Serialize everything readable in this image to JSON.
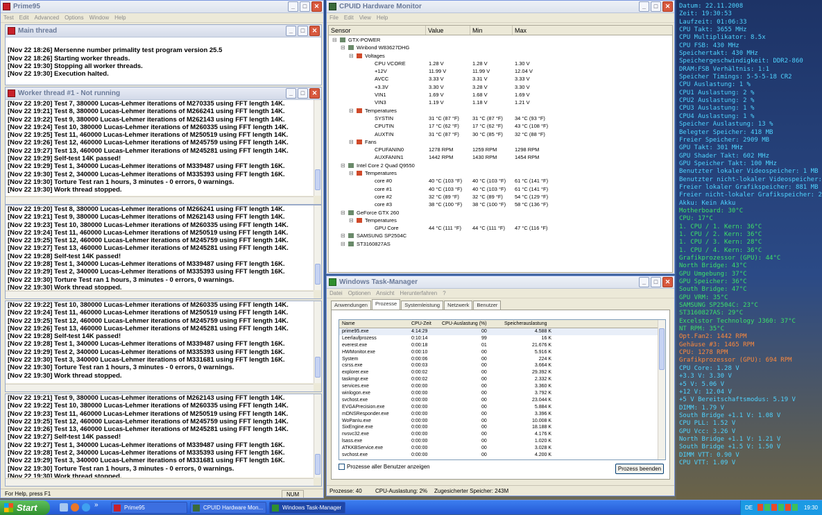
{
  "prime95": {
    "title": "Prime95",
    "menu": [
      "Test",
      "Edit",
      "Advanced",
      "Options",
      "Window",
      "Help"
    ],
    "main_thread": {
      "title": "Main thread",
      "lines": [
        "",
        "[Nov 22 18:26] Mersenne number primality test program version 25.5",
        "[Nov 22 18:26] Starting worker threads.",
        "[Nov 22 19:30] Stopping all worker threads.",
        "[Nov 22 19:30] Execution halted."
      ]
    },
    "worker1": {
      "title": "Worker thread #1 - Not running",
      "lines": [
        "[Nov 22 19:20] Test 7, 380000 Lucas-Lehmer iterations of M270335 using FFT length 14K.",
        "[Nov 22 19:21] Test 8, 380000 Lucas-Lehmer iterations of M266241 using FFT length 14K.",
        "[Nov 22 19:22] Test 9, 380000 Lucas-Lehmer iterations of M262143 using FFT length 14K.",
        "[Nov 22 19:24] Test 10, 380000 Lucas-Lehmer iterations of M260335 using FFT length 14K.",
        "[Nov 22 19:25] Test 11, 460000 Lucas-Lehmer iterations of M250519 using FFT length 14K.",
        "[Nov 22 19:26] Test 12, 460000 Lucas-Lehmer iterations of M245759 using FFT length 14K.",
        "[Nov 22 19:27] Test 13, 460000 Lucas-Lehmer iterations of M245281 using FFT length 14K.",
        "[Nov 22 19:29] Self-test 14K passed!",
        "[Nov 22 19:29] Test 1, 340000 Lucas-Lehmer iterations of M339487 using FFT length 16K.",
        "[Nov 22 19:30] Test 2, 340000 Lucas-Lehmer iterations of M335393 using FFT length 16K.",
        "[Nov 22 19:30] Torture Test ran 1 hours, 3 minutes - 0 errors, 0 warnings.",
        "[Nov 22 19:30] Work thread stopped."
      ]
    },
    "worker2": {
      "lines": [
        "[Nov 22 19:20] Test 8, 380000 Lucas-Lehmer iterations of M266241 using FFT length 14K.",
        "[Nov 22 19:21] Test 9, 380000 Lucas-Lehmer iterations of M262143 using FFT length 14K.",
        "[Nov 22 19:23] Test 10, 380000 Lucas-Lehmer iterations of M260335 using FFT length 14K.",
        "[Nov 22 19:24] Test 11, 460000 Lucas-Lehmer iterations of M250519 using FFT length 14K.",
        "[Nov 22 19:25] Test 12, 460000 Lucas-Lehmer iterations of M245759 using FFT length 14K.",
        "[Nov 22 19:27] Test 13, 460000 Lucas-Lehmer iterations of M245281 using FFT length 14K.",
        "[Nov 22 19:28] Self-test 14K passed!",
        "[Nov 22 19:28] Test 1, 340000 Lucas-Lehmer iterations of M339487 using FFT length 16K.",
        "[Nov 22 19:29] Test 2, 340000 Lucas-Lehmer iterations of M335393 using FFT length 16K.",
        "[Nov 22 19:30] Torture Test ran 1 hours, 3 minutes - 0 errors, 0 warnings.",
        "[Nov 22 19:30] Work thread stopped."
      ]
    },
    "worker3": {
      "lines": [
        "[Nov 22 19:22] Test 10, 380000 Lucas-Lehmer iterations of M260335 using FFT length 14K.",
        "[Nov 22 19:24] Test 11, 460000 Lucas-Lehmer iterations of M250519 using FFT length 14K.",
        "[Nov 22 19:25] Test 12, 460000 Lucas-Lehmer iterations of M245759 using FFT length 14K.",
        "[Nov 22 19:26] Test 13, 460000 Lucas-Lehmer iterations of M245281 using FFT length 14K.",
        "[Nov 22 19:28] Self-test 14K passed!",
        "[Nov 22 19:28] Test 1, 340000 Lucas-Lehmer iterations of M339487 using FFT length 16K.",
        "[Nov 22 19:29] Test 2, 340000 Lucas-Lehmer iterations of M335393 using FFT length 16K.",
        "[Nov 22 19:30] Test 3, 340000 Lucas-Lehmer iterations of M331681 using FFT length 16K.",
        "[Nov 22 19:30] Torture Test ran 1 hours, 3 minutes - 0 errors, 0 warnings.",
        "[Nov 22 19:30] Work thread stopped."
      ]
    },
    "worker4": {
      "lines": [
        "[Nov 22 19:21] Test 9, 380000 Lucas-Lehmer iterations of M262143 using FFT length 14K.",
        "[Nov 22 19:22] Test 10, 380000 Lucas-Lehmer iterations of M260335 using FFT length 14K.",
        "[Nov 22 19:23] Test 11, 460000 Lucas-Lehmer iterations of M250519 using FFT length 14K.",
        "[Nov 22 19:25] Test 12, 460000 Lucas-Lehmer iterations of M245759 using FFT length 14K.",
        "[Nov 22 19:26] Test 13, 460000 Lucas-Lehmer iterations of M245281 using FFT length 14K.",
        "[Nov 22 19:27] Self-test 14K passed!",
        "[Nov 22 19:27] Test 1, 340000 Lucas-Lehmer iterations of M339487 using FFT length 16K.",
        "[Nov 22 19:28] Test 2, 340000 Lucas-Lehmer iterations of M335393 using FFT length 16K.",
        "[Nov 22 19:29] Test 3, 340000 Lucas-Lehmer iterations of M331681 using FFT length 16K.",
        "[Nov 22 19:30] Torture Test ran 1 hours, 3 minutes - 0 errors, 0 warnings.",
        "[Nov 22 19:30] Work thread stopped."
      ]
    },
    "status_left": "For Help, press F1",
    "status_right": "NUM"
  },
  "hwmon": {
    "title": "CPUID Hardware Monitor",
    "menu": [
      "File",
      "Edit",
      "View",
      "Help"
    ],
    "columns": [
      "Sensor",
      "Value",
      "Min",
      "Max"
    ],
    "rows": [
      {
        "l": 0,
        "t": "GTX-POWER",
        "v": "",
        "mn": "",
        "mx": ""
      },
      {
        "l": 1,
        "t": "Winbond W83627DHG",
        "v": "",
        "mn": "",
        "mx": ""
      },
      {
        "l": 2,
        "t": "Voltages",
        "v": "",
        "mn": "",
        "mx": ""
      },
      {
        "l": 3,
        "t": "CPU VCORE",
        "v": "1.28 V",
        "mn": "1.28 V",
        "mx": "1.30 V"
      },
      {
        "l": 3,
        "t": "+12V",
        "v": "11.99 V",
        "mn": "11.99 V",
        "mx": "12.04 V"
      },
      {
        "l": 3,
        "t": "AVCC",
        "v": "3.33 V",
        "mn": "3.31 V",
        "mx": "3.33 V"
      },
      {
        "l": 3,
        "t": "+3.3V",
        "v": "3.30 V",
        "mn": "3.28 V",
        "mx": "3.30 V"
      },
      {
        "l": 3,
        "t": "VIN1",
        "v": "1.69 V",
        "mn": "1.68 V",
        "mx": "1.69 V"
      },
      {
        "l": 3,
        "t": "VIN3",
        "v": "1.19 V",
        "mn": "1.18 V",
        "mx": "1.21 V"
      },
      {
        "l": 2,
        "t": "Temperatures",
        "v": "",
        "mn": "",
        "mx": ""
      },
      {
        "l": 3,
        "t": "SYSTIN",
        "v": "31 °C (87 °F)",
        "mn": "31 °C (87 °F)",
        "mx": "34 °C (93 °F)"
      },
      {
        "l": 3,
        "t": "CPUTIN",
        "v": "17 °C (62 °F)",
        "mn": "17 °C (62 °F)",
        "mx": "43 °C (108 °F)"
      },
      {
        "l": 3,
        "t": "AUXTIN",
        "v": "31 °C (87 °F)",
        "mn": "30 °C (85 °F)",
        "mx": "32 °C (88 °F)"
      },
      {
        "l": 2,
        "t": "Fans",
        "v": "",
        "mn": "",
        "mx": ""
      },
      {
        "l": 3,
        "t": "CPUFANIN0",
        "v": "1278 RPM",
        "mn": "1259 RPM",
        "mx": "1298 RPM"
      },
      {
        "l": 3,
        "t": "AUXFANIN1",
        "v": "1442 RPM",
        "mn": "1430 RPM",
        "mx": "1454 RPM"
      },
      {
        "l": 1,
        "t": "Intel Core 2 Quad Q9550",
        "v": "",
        "mn": "",
        "mx": ""
      },
      {
        "l": 2,
        "t": "Temperatures",
        "v": "",
        "mn": "",
        "mx": ""
      },
      {
        "l": 3,
        "t": "core #0",
        "v": "40 °C (103 °F)",
        "mn": "40 °C (103 °F)",
        "mx": "61 °C (141 °F)"
      },
      {
        "l": 3,
        "t": "core #1",
        "v": "40 °C (103 °F)",
        "mn": "40 °C (103 °F)",
        "mx": "61 °C (141 °F)"
      },
      {
        "l": 3,
        "t": "core #2",
        "v": "32 °C (89 °F)",
        "mn": "32 °C (89 °F)",
        "mx": "54 °C (129 °F)"
      },
      {
        "l": 3,
        "t": "core #3",
        "v": "38 °C (100 °F)",
        "mn": "38 °C (100 °F)",
        "mx": "58 °C (136 °F)"
      },
      {
        "l": 1,
        "t": "GeForce GTX 260",
        "v": "",
        "mn": "",
        "mx": ""
      },
      {
        "l": 2,
        "t": "Temperatures",
        "v": "",
        "mn": "",
        "mx": ""
      },
      {
        "l": 3,
        "t": "GPU Core",
        "v": "44 °C (111 °F)",
        "mn": "44 °C (111 °F)",
        "mx": "47 °C (116 °F)"
      },
      {
        "l": 1,
        "t": "SAMSUNG SP2504C",
        "v": "",
        "mn": "",
        "mx": ""
      },
      {
        "l": 1,
        "t": "ST3160827AS",
        "v": "",
        "mn": "",
        "mx": ""
      }
    ]
  },
  "taskmgr": {
    "title": "Windows Task-Manager",
    "menu": [
      "Datei",
      "Optionen",
      "Ansicht",
      "Herunterfahren",
      "?"
    ],
    "tabs": [
      "Anwendungen",
      "Prozesse",
      "Systemleistung",
      "Netzwerk",
      "Benutzer"
    ],
    "columns": [
      "Name",
      "CPU-Zeit",
      "CPU-Auslastung (%)",
      "Speicherauslastung"
    ],
    "rows": [
      [
        "prime95.exe",
        "4:14:29",
        "00",
        "4.588 K"
      ],
      [
        "Leerlaufprozess",
        "0:10:14",
        "99",
        "16 K"
      ],
      [
        "everest.exe",
        "0:00:18",
        "01",
        "21.676 K"
      ],
      [
        "HWMonitor.exe",
        "0:00:10",
        "00",
        "5.916 K"
      ],
      [
        "System",
        "0:00:06",
        "00",
        "224 K"
      ],
      [
        "csrss.exe",
        "0:00:03",
        "00",
        "3.664 K"
      ],
      [
        "explorer.exe",
        "0:00:02",
        "00",
        "29.392 K"
      ],
      [
        "taskmgr.exe",
        "0:00:02",
        "00",
        "2.332 K"
      ],
      [
        "services.exe",
        "0:00:00",
        "00",
        "3.360 K"
      ],
      [
        "winlogon.exe",
        "0:00:00",
        "00",
        "3.792 K"
      ],
      [
        "svchost.exe",
        "0:00:00",
        "00",
        "23.044 K"
      ],
      [
        "EVGAPrecision.exe",
        "0:00:00",
        "00",
        "5.884 K"
      ],
      [
        "mDNSResponder.exe",
        "0:00:00",
        "00",
        "3.396 K"
      ],
      [
        "WoPanIu.exe",
        "0:00:00",
        "00",
        "10.008 K"
      ],
      [
        "SixEngine.exe",
        "0:00:00",
        "00",
        "18.188 K"
      ],
      [
        "nvsvc32.exe",
        "0:00:00",
        "00",
        "4.176 K"
      ],
      [
        "lsass.exe",
        "0:00:00",
        "00",
        "1.020 K"
      ],
      [
        "ATKKBService.exe",
        "0:00:00",
        "00",
        "3.028 K"
      ],
      [
        "svchost.exe",
        "0:00:00",
        "00",
        "4.200 K"
      ]
    ],
    "show_all_label": "Prozesse aller Benutzer anzeigen",
    "end_process_label": "Prozess beenden",
    "status": [
      "Prozesse: 40",
      "CPU-Auslastung: 2%",
      "Zugesicherter Speicher: 243M"
    ]
  },
  "everest_overlay": {
    "lines": [
      {
        "t": "Datum: 22.11.2008",
        "c": "#4fd3ff"
      },
      {
        "t": "Zeit: 19:30:53",
        "c": "#4fd3ff"
      },
      {
        "t": "Laufzeit: 01:06:33",
        "c": "#4fd3ff"
      },
      {
        "t": "CPU Takt: 3655 MHz",
        "c": "#4fd3ff"
      },
      {
        "t": "CPU Multiplikator: 8.5x",
        "c": "#4fd3ff"
      },
      {
        "t": "CPU FSB: 430 MHz",
        "c": "#4fd3ff"
      },
      {
        "t": "Speichertakt: 430 MHz",
        "c": "#4fd3ff"
      },
      {
        "t": "Speichergeschwindigkeit: DDR2-860",
        "c": "#4fd3ff"
      },
      {
        "t": "DRAM:FSB Verhältnis: 1:1",
        "c": "#4fd3ff"
      },
      {
        "t": "Speicher Timings: 5-5-5-18 CR2",
        "c": "#4fd3ff"
      },
      {
        "t": "CPU Auslastung: 1 %",
        "c": "#4fd3ff"
      },
      {
        "t": "CPU1 Auslastung: 2 %",
        "c": "#4fd3ff"
      },
      {
        "t": "CPU2 Auslastung: 2 %",
        "c": "#4fd3ff"
      },
      {
        "t": "CPU3 Auslastung: 1 %",
        "c": "#4fd3ff"
      },
      {
        "t": "CPU4 Auslastung: 1 %",
        "c": "#4fd3ff"
      },
      {
        "t": "Speicher Auslastung: 13 %",
        "c": "#4fd3ff"
      },
      {
        "t": "Belegter Speicher: 418 MB",
        "c": "#4fd3ff"
      },
      {
        "t": "Freier Speicher: 2909 MB",
        "c": "#4fd3ff"
      },
      {
        "t": "GPU Takt: 301 MHz",
        "c": "#4fd3ff"
      },
      {
        "t": "GPU Shader Takt: 602 MHz",
        "c": "#4fd3ff"
      },
      {
        "t": "GPU Speicher Takt: 100 MHz",
        "c": "#4fd3ff"
      },
      {
        "t": "Benutzter lokaler Videospeicher: 1 MB",
        "c": "#4fd3ff"
      },
      {
        "t": "Benutzter nicht-lokaler Videospeicher: 0 MB",
        "c": "#4fd3ff"
      },
      {
        "t": "Freier lokaler Grafikspeicher: 881 MB",
        "c": "#4fd3ff"
      },
      {
        "t": "Freier nicht-lokaler Grafikspeicher: 246 MB",
        "c": "#4fd3ff"
      },
      {
        "t": "Akku: Kein Akku",
        "c": "#4fd3ff"
      },
      {
        "t": "Motherboard: 30°C",
        "c": "#3ee06a"
      },
      {
        "t": "CPU: 17°C",
        "c": "#3ee06a"
      },
      {
        "t": "1. CPU / 1. Kern: 36°C",
        "c": "#3ee06a"
      },
      {
        "t": "1. CPU / 2. Kern: 36°C",
        "c": "#3ee06a"
      },
      {
        "t": "1. CPU / 3. Kern: 28°C",
        "c": "#3ee06a"
      },
      {
        "t": "1. CPU / 4. Kern: 36°C",
        "c": "#3ee06a"
      },
      {
        "t": "Grafikprozessor (GPU): 44°C",
        "c": "#3ee06a"
      },
      {
        "t": "North Bridge: 43°C",
        "c": "#3ee06a"
      },
      {
        "t": "GPU Umgebung: 37°C",
        "c": "#3ee06a"
      },
      {
        "t": "GPU Speicher: 36°C",
        "c": "#3ee06a"
      },
      {
        "t": "South Bridge: 47°C",
        "c": "#3ee06a"
      },
      {
        "t": "GPU VRM: 35°C",
        "c": "#3ee06a"
      },
      {
        "t": "SAMSUNG SP2504C: 23°C",
        "c": "#3ee06a"
      },
      {
        "t": "ST3160827AS: 29°C",
        "c": "#3ee06a"
      },
      {
        "t": "Excelstor Technology J360: 37°C",
        "c": "#3ee06a"
      },
      {
        "t": "NT RPM: 35°C",
        "c": "#3ee06a"
      },
      {
        "t": "Opt.Fan2: 1442 RPM",
        "c": "#ff8a3c"
      },
      {
        "t": "Gehäuse #3: 1465 RPM",
        "c": "#ff8a3c"
      },
      {
        "t": "CPU: 1278 RPM",
        "c": "#ff8a3c"
      },
      {
        "t": "Grafikprozessor (GPU): 694 RPM",
        "c": "#ff8a3c"
      },
      {
        "t": "CPU Core: 1.28 V",
        "c": "#4fd3ff"
      },
      {
        "t": "+3.3 V: 3.30 V",
        "c": "#4fd3ff"
      },
      {
        "t": "+5 V: 5.06 V",
        "c": "#4fd3ff"
      },
      {
        "t": "+12 V: 12.04 V",
        "c": "#4fd3ff"
      },
      {
        "t": "+5 V Bereitschaftsmodus: 5.19 V",
        "c": "#4fd3ff"
      },
      {
        "t": "DIMM: 1.79 V",
        "c": "#4fd3ff"
      },
      {
        "t": "South Bridge +1.1 V: 1.08 V",
        "c": "#4fd3ff"
      },
      {
        "t": "CPU PLL: 1.52 V",
        "c": "#4fd3ff"
      },
      {
        "t": "GPU Vcc: 3.26 V",
        "c": "#4fd3ff"
      },
      {
        "t": "North Bridge +1.1 V: 1.21 V",
        "c": "#4fd3ff"
      },
      {
        "t": "South Bridge +1.5 V: 1.50 V",
        "c": "#4fd3ff"
      },
      {
        "t": "DIMM VTT: 0.90 V",
        "c": "#4fd3ff"
      },
      {
        "t": "CPU VTT: 1.09 V",
        "c": "#4fd3ff"
      }
    ]
  },
  "taskbar": {
    "start_label": "Start",
    "buttons": [
      "Prime95",
      "CPUID Hardware Mon...",
      "Windows Task-Manager"
    ],
    "tray_lang": "DE",
    "clock": "19:30"
  }
}
